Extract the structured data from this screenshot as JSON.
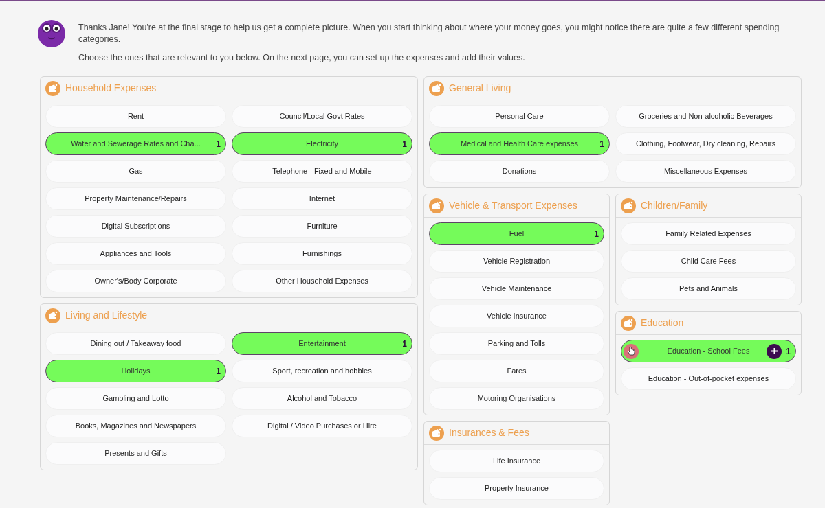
{
  "intro": {
    "paragraphs": [
      "Thanks Jane! You're at the final stage to help us get a complete picture. When you start thinking about where your money goes, you might notice there are quite a few different spending categories.",
      "Choose the ones that are relevant to you below. On the next page, you can set up the expenses and add their values."
    ]
  },
  "columns": [
    {
      "groups": [
        {
          "title": "Household Expenses",
          "items": [
            {
              "label": "Rent",
              "selected": false
            },
            {
              "label": "Council/Local Govt Rates",
              "selected": false
            },
            {
              "label": "Water and Sewerage Rates and Cha...",
              "selected": true,
              "count": "1"
            },
            {
              "label": "Electricity",
              "selected": true,
              "count": "1"
            },
            {
              "label": "Gas",
              "selected": false
            },
            {
              "label": "Telephone - Fixed and Mobile",
              "selected": false
            },
            {
              "label": "Property Maintenance/Repairs",
              "selected": false
            },
            {
              "label": "Internet",
              "selected": false
            },
            {
              "label": "Digital Subscriptions",
              "selected": false
            },
            {
              "label": "Furniture",
              "selected": false
            },
            {
              "label": "Appliances and Tools",
              "selected": false
            },
            {
              "label": "Furnishings",
              "selected": false
            },
            {
              "label": "Owner's/Body Corporate",
              "selected": false
            },
            {
              "label": "Other Household Expenses",
              "selected": false
            }
          ]
        },
        {
          "title": "Living and Lifestyle",
          "items": [
            {
              "label": "Dining out / Takeaway food",
              "selected": false
            },
            {
              "label": "Entertainment",
              "selected": true,
              "count": "1"
            },
            {
              "label": "Holidays",
              "selected": true,
              "count": "1"
            },
            {
              "label": "Sport, recreation and hobbies",
              "selected": false
            },
            {
              "label": "Gambling and Lotto",
              "selected": false
            },
            {
              "label": "Alcohol and Tobacco",
              "selected": false
            },
            {
              "label": "Books, Magazines and Newspapers",
              "selected": false
            },
            {
              "label": "Digital / Video Purchases or Hire",
              "selected": false
            },
            {
              "label": "Presents and Gifts",
              "selected": false
            }
          ]
        }
      ]
    },
    {
      "groups": [
        {
          "title": "General Living",
          "items": [
            {
              "label": "Personal Care",
              "selected": false
            },
            {
              "label": "Groceries and Non-alcoholic Beverages",
              "selected": false
            },
            {
              "label": "Medical and Health Care expenses",
              "selected": true,
              "count": "1"
            },
            {
              "label": "Clothing, Footwear, Dry cleaning, Repairs",
              "selected": false
            },
            {
              "label": "Donations",
              "selected": false
            },
            {
              "label": "Miscellaneous Expenses",
              "selected": false
            }
          ]
        }
      ],
      "subcolumns": [
        {
          "groups": [
            {
              "title": "Vehicle & Transport Expenses",
              "items": [
                {
                  "label": "Fuel",
                  "selected": true,
                  "count": "1"
                },
                {
                  "label": "Vehicle Registration",
                  "selected": false
                },
                {
                  "label": "Vehicle Maintenance",
                  "selected": false
                },
                {
                  "label": "Vehicle Insurance",
                  "selected": false
                },
                {
                  "label": "Parking and Tolls",
                  "selected": false
                },
                {
                  "label": "Fares",
                  "selected": false
                },
                {
                  "label": "Motoring Organisations",
                  "selected": false
                }
              ]
            },
            {
              "title": "Insurances & Fees",
              "items": [
                {
                  "label": "Life Insurance",
                  "selected": false
                },
                {
                  "label": "Property Insurance",
                  "selected": false
                }
              ]
            }
          ]
        },
        {
          "groups": [
            {
              "title": "Children/Family",
              "items": [
                {
                  "label": "Family Related Expenses",
                  "selected": false
                },
                {
                  "label": "Child Care Fees",
                  "selected": false
                },
                {
                  "label": "Pets and Animals",
                  "selected": false
                }
              ]
            },
            {
              "title": "Education",
              "items": [
                {
                  "label": "Education - School Fees",
                  "selected": true,
                  "count": "1",
                  "hovered": true
                },
                {
                  "label": "Education - Out-of-pocket expenses",
                  "selected": false
                }
              ]
            }
          ]
        }
      ]
    }
  ]
}
